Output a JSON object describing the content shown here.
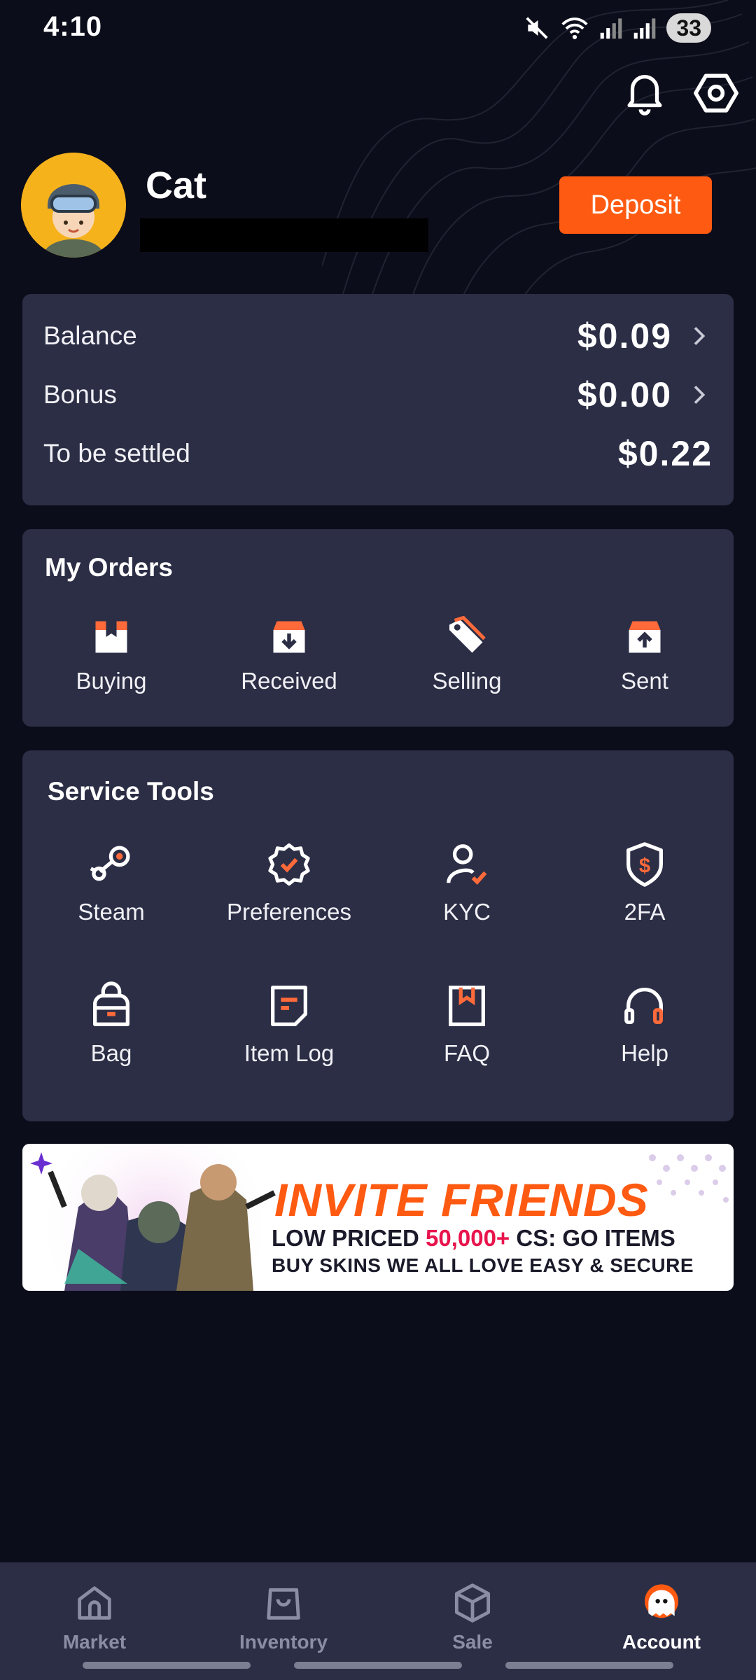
{
  "status_bar": {
    "time": "4:10",
    "battery": "33"
  },
  "profile": {
    "name": "Cat",
    "deposit_label": "Deposit"
  },
  "balance": {
    "rows": [
      {
        "label": "Balance",
        "value": "$0.09"
      },
      {
        "label": "Bonus",
        "value": "$0.00"
      },
      {
        "label": "To be settled",
        "value": "$0.22"
      }
    ]
  },
  "orders": {
    "title": "My Orders",
    "items": [
      {
        "label": "Buying",
        "icon": "box-bookmark-icon"
      },
      {
        "label": "Received",
        "icon": "box-download-icon"
      },
      {
        "label": "Selling",
        "icon": "tag-icon"
      },
      {
        "label": "Sent",
        "icon": "box-upload-icon"
      }
    ]
  },
  "tools": {
    "title": "Service Tools",
    "items": [
      {
        "label": "Steam",
        "icon": "steam-icon"
      },
      {
        "label": "Preferences",
        "icon": "badge-check-icon"
      },
      {
        "label": "KYC",
        "icon": "user-check-icon"
      },
      {
        "label": "2FA",
        "icon": "shield-dollar-icon"
      },
      {
        "label": "Bag",
        "icon": "backpack-icon"
      },
      {
        "label": "Item Log",
        "icon": "note-icon"
      },
      {
        "label": "FAQ",
        "icon": "book-icon"
      },
      {
        "label": "Help",
        "icon": "headset-icon"
      }
    ]
  },
  "banner": {
    "title": "INVITE FRIENDS",
    "line1_prefix": "LOW PRICED ",
    "line1_accent": "50,000+",
    "line1_suffix": " CS: GO ITEMS",
    "line2": "BUY SKINS WE ALL LOVE EASY & SECURE"
  },
  "nav": {
    "items": [
      {
        "label": "Market",
        "icon": "home-icon"
      },
      {
        "label": "Inventory",
        "icon": "bag-icon"
      },
      {
        "label": "Sale",
        "icon": "cube-icon"
      },
      {
        "label": "Account",
        "icon": "ghost-avatar-icon",
        "active": true
      }
    ]
  },
  "colors": {
    "accent": "#ff5a11",
    "card": "#2b2e45",
    "background": "#0c0d1a",
    "highlight": "#e8144c"
  }
}
